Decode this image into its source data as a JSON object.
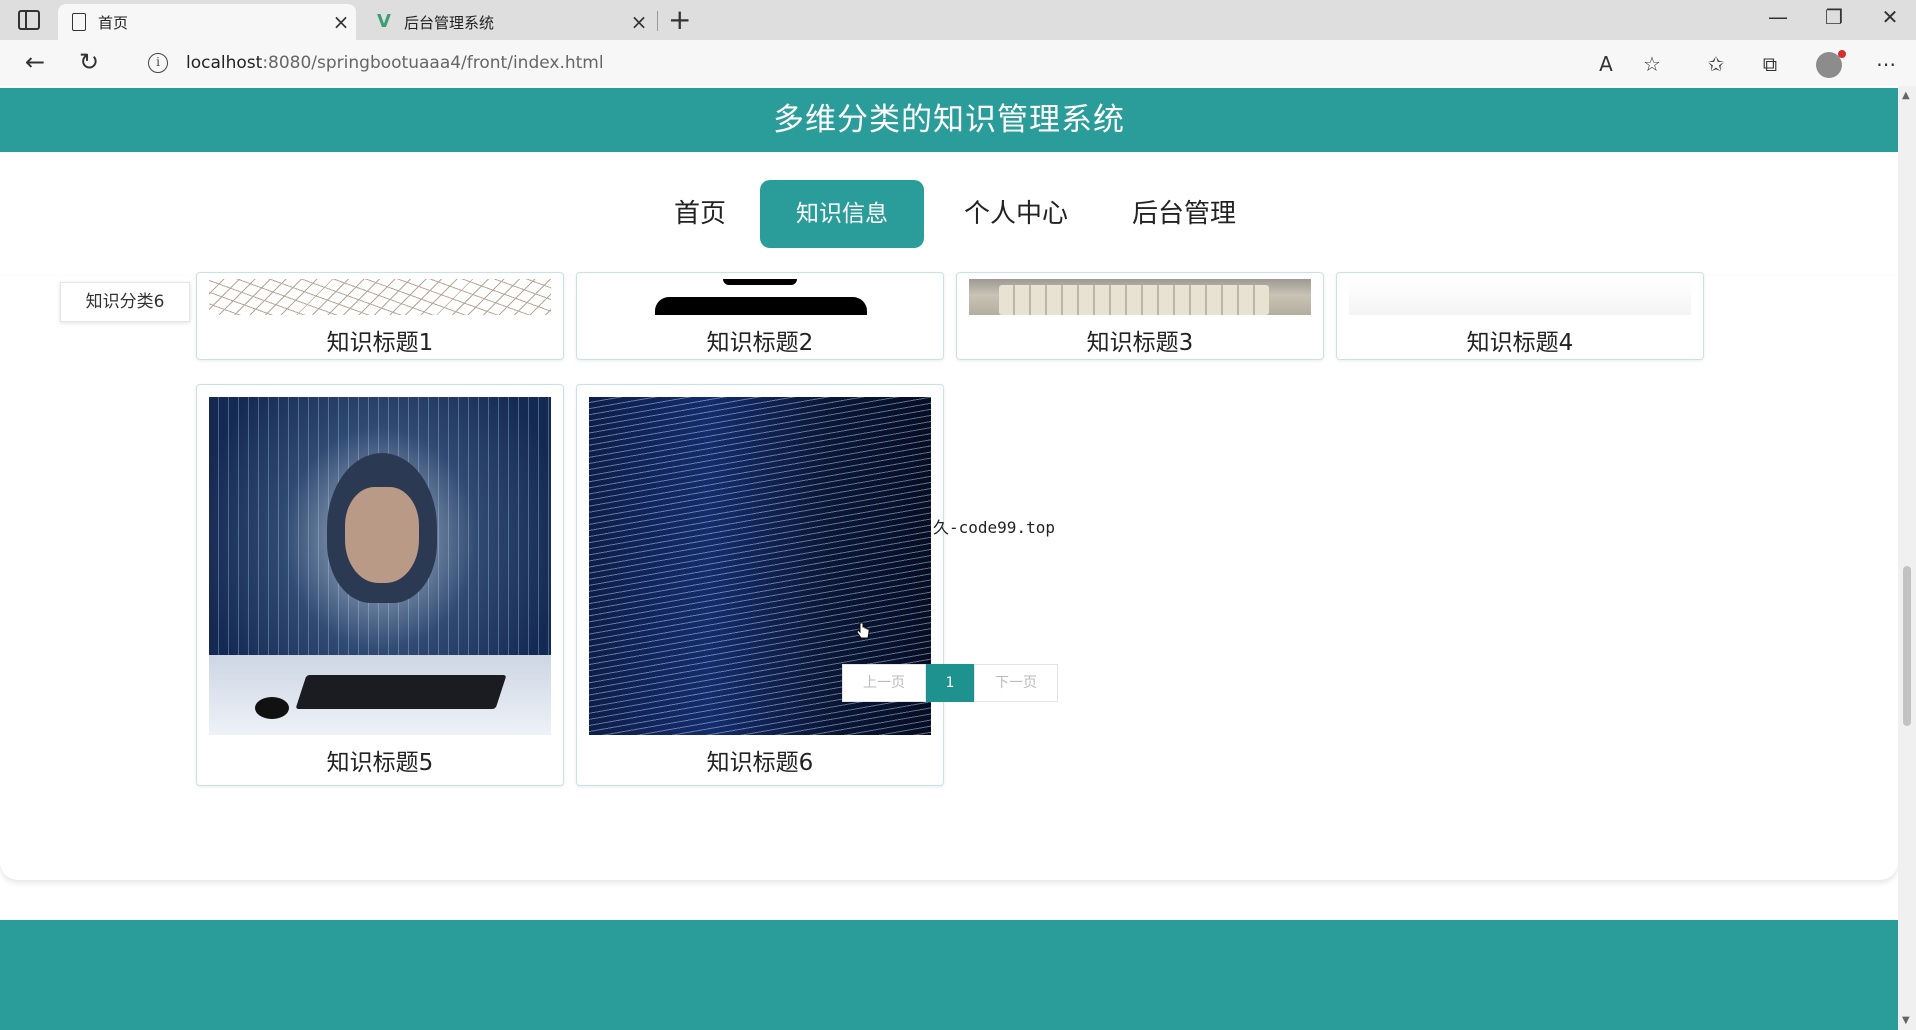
{
  "browser": {
    "tabs": [
      {
        "title": "首页",
        "icon": "document-icon",
        "active": true
      },
      {
        "title": "后台管理系统",
        "icon": "vue-logo-icon",
        "active": false
      }
    ],
    "address": {
      "host": "localhost",
      "path": ":8080/springbootuaaa4/front/index.html"
    }
  },
  "site": {
    "title": "多维分类的知识管理系统",
    "nav": [
      {
        "label": "首页",
        "active": false
      },
      {
        "label": "知识信息",
        "active": true
      },
      {
        "label": "个人中心",
        "active": false
      },
      {
        "label": "后台管理",
        "active": false
      }
    ],
    "category_tab": "知识分类6",
    "cards": [
      {
        "title": "知识标题1",
        "image": "grid-pattern"
      },
      {
        "title": "知识标题2",
        "image": "phone"
      },
      {
        "title": "知识标题3",
        "image": "keyboard"
      },
      {
        "title": "知识标题4",
        "image": "light"
      },
      {
        "title": "知识标题5",
        "image": "hacker"
      },
      {
        "title": "知识标题6",
        "image": "code-stream"
      }
    ],
    "pagination": {
      "prev": "上一页",
      "current": "1",
      "next": "下一页"
    },
    "overlay_text": "久-code99.top",
    "colors": {
      "accent": "#2a9d9a",
      "page_active": "#1e928f"
    }
  }
}
